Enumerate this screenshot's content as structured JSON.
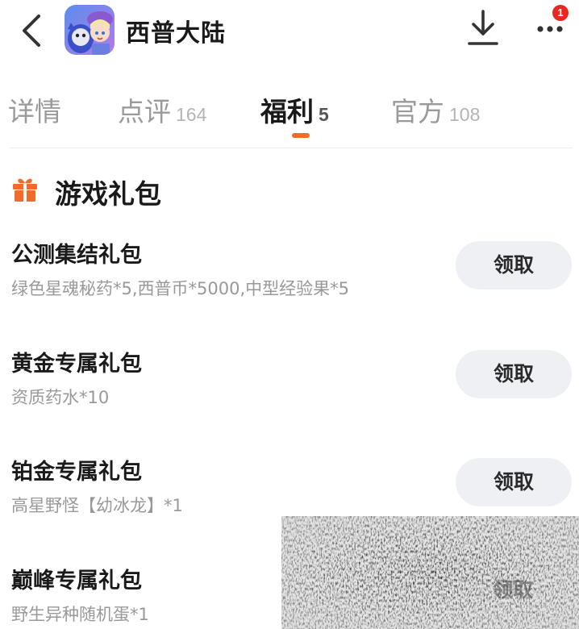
{
  "header": {
    "title": "西普大陆",
    "more_badge": "1"
  },
  "tabs": [
    {
      "label": "详情",
      "count": ""
    },
    {
      "label": "点评",
      "count": "164"
    },
    {
      "label": "福利",
      "count": "5"
    },
    {
      "label": "官方",
      "count": "108"
    }
  ],
  "active_tab": "福利",
  "section": {
    "title": "游戏礼包"
  },
  "gifts": [
    {
      "name": "公测集结礼包",
      "desc": "绿色星魂秘药*5,西普币*5000,中型经验果*5",
      "button": "领取"
    },
    {
      "name": "黄金专属礼包",
      "desc": "资质药水*10",
      "button": "领取"
    },
    {
      "name": "铂金专属礼包",
      "desc": "高星野怪【幼冰龙】*1",
      "button": "领取"
    },
    {
      "name": "巅峰专属礼包",
      "desc": "野生异种随机蛋*1",
      "button": "领取"
    }
  ],
  "colors": {
    "accent": "#f26b2b",
    "badge": "#e8281e",
    "button_bg": "#eef0f4"
  },
  "icons": {
    "back": "chevron-left-icon",
    "download": "download-icon",
    "more": "more-dots-icon",
    "gift": "gift-icon",
    "app": "app-icon"
  }
}
